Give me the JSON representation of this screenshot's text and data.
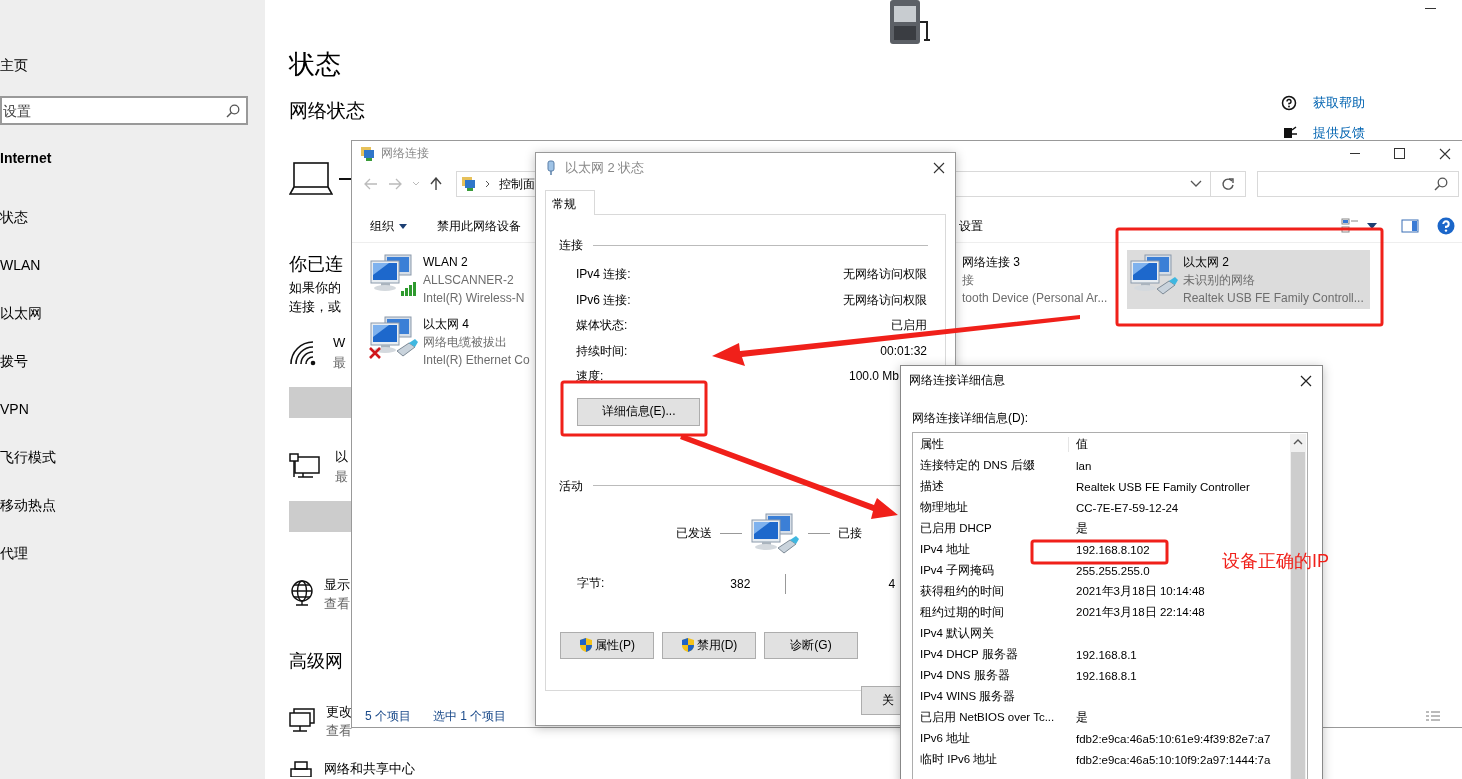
{
  "settings": {
    "sidebar": {
      "home": "主页",
      "search": {
        "placeholder": "设置"
      },
      "section": "Internet",
      "items": [
        {
          "label": "状态"
        },
        {
          "label": "WLAN"
        },
        {
          "label": "以太网"
        },
        {
          "label": "拨号"
        },
        {
          "label": "VPN"
        },
        {
          "label": "飞行模式"
        },
        {
          "label": "移动热点"
        },
        {
          "label": "代理"
        }
      ]
    },
    "page": {
      "title": "状态",
      "subtitle": "网络状态",
      "connected_heading": "你已连",
      "description": [
        "如果你的",
        "连接，或"
      ],
      "connections": [
        {
          "kind": "wifi",
          "name": "W",
          "detail": "最"
        },
        {
          "kind": "ethernet",
          "name": "以",
          "detail": "最"
        }
      ],
      "options": [
        {
          "kind": "globe",
          "title": "显示",
          "detail": "查看"
        }
      ],
      "advanced_heading": "高级网",
      "advanced": [
        {
          "kind": "monitor",
          "title": "更改",
          "detail": "查看"
        },
        {
          "kind": "printer",
          "title": "网络和共享中心"
        }
      ]
    },
    "help_links": [
      {
        "kind": "help",
        "label": "获取帮助"
      },
      {
        "kind": "feedback",
        "label": "提供反馈"
      }
    ]
  },
  "connections_window": {
    "title": "网络连接",
    "breadcrumb": "控制面",
    "commands": [
      {
        "label": "组织",
        "menu": true
      },
      {
        "label": "禁用此网络设备",
        "menu": false
      }
    ],
    "command_cut": "设置",
    "columns": [
      [
        {
          "kind": "wifi",
          "name": "WLAN 2",
          "status": "ALLSCANNER-2",
          "device": "Intel(R) Wireless-N",
          "disconnected": false,
          "selected": false
        },
        {
          "kind": "ethernet",
          "name": "以太网 4",
          "status": "网络电缆被拔出",
          "device": "Intel(R) Ethernet Co",
          "disconnected": true,
          "selected": false
        }
      ],
      [
        {
          "name": "网络连接 3",
          "status": "接",
          "device": "tooth Device (Personal Ar...",
          "selected": false
        }
      ],
      [
        {
          "kind": "ethernet",
          "name": "以太网 2",
          "status": "未识别的网络",
          "device": "Realtek USB FE Family Controll...",
          "disconnected": false,
          "selected": true
        }
      ]
    ],
    "status_bar": [
      "5 个项目",
      "选中 1 个项目"
    ]
  },
  "status_dialog": {
    "title": "以太网 2 状态",
    "tab": "常规",
    "connection_heading": "连接",
    "rows": [
      {
        "label": "IPv4 连接:",
        "value": "无网络访问权限"
      },
      {
        "label": "IPv6 连接:",
        "value": "无网络访问权限"
      },
      {
        "label": "媒体状态:",
        "value": "已启用"
      },
      {
        "label": "持续时间:",
        "value": "00:01:32"
      },
      {
        "label": "速度:",
        "value": "100.0 Mb"
      }
    ],
    "details_button": "详细信息(E)...",
    "activity_heading": "活动",
    "sent_label": "已发送",
    "received_label": "已接",
    "bytes_label": "字节:",
    "bytes_sent": "382",
    "bytes_received": "4",
    "buttons": [
      {
        "label": "属性(P)",
        "shield": true
      },
      {
        "label": "禁用(D)",
        "shield": true
      },
      {
        "label": "诊断(G)",
        "shield": false
      }
    ],
    "close_button": "关"
  },
  "details_dialog": {
    "title": "网络连接详细信息",
    "list_label": "网络连接详细信息(D):",
    "columns": [
      "属性",
      "值"
    ],
    "rows": [
      {
        "property": "连接特定的 DNS 后缀",
        "value": "lan"
      },
      {
        "property": "描述",
        "value": "Realtek USB FE Family Controller"
      },
      {
        "property": "物理地址",
        "value": "CC-7E-E7-59-12-24"
      },
      {
        "property": "已启用 DHCP",
        "value": "是"
      },
      {
        "property": "IPv4 地址",
        "value": "192.168.8.102"
      },
      {
        "property": "IPv4 子网掩码",
        "value": "255.255.255.0"
      },
      {
        "property": "获得租约的时间",
        "value": "2021年3月18日 10:14:48"
      },
      {
        "property": "租约过期的时间",
        "value": "2021年3月18日 22:14:48"
      },
      {
        "property": "IPv4 默认网关"
      },
      {
        "property": "IPv4 DHCP 服务器",
        "value": "192.168.8.1"
      },
      {
        "property": "IPv4 DNS 服务器",
        "value": "192.168.8.1"
      },
      {
        "property": "IPv4 WINS 服务器"
      },
      {
        "property": "已启用 NetBIOS over Tc...",
        "value": "是"
      },
      {
        "property": "IPv6 地址",
        "value": "fdb2:e9ca:46a5:10:61e9:4f39:82e7:a7"
      },
      {
        "property": "临时 IPv6 地址",
        "value": "fdb2:e9ca:46a5:10:10f9:2a97:1444:7a"
      }
    ]
  },
  "annotation": {
    "label": "设备正确的IP"
  }
}
